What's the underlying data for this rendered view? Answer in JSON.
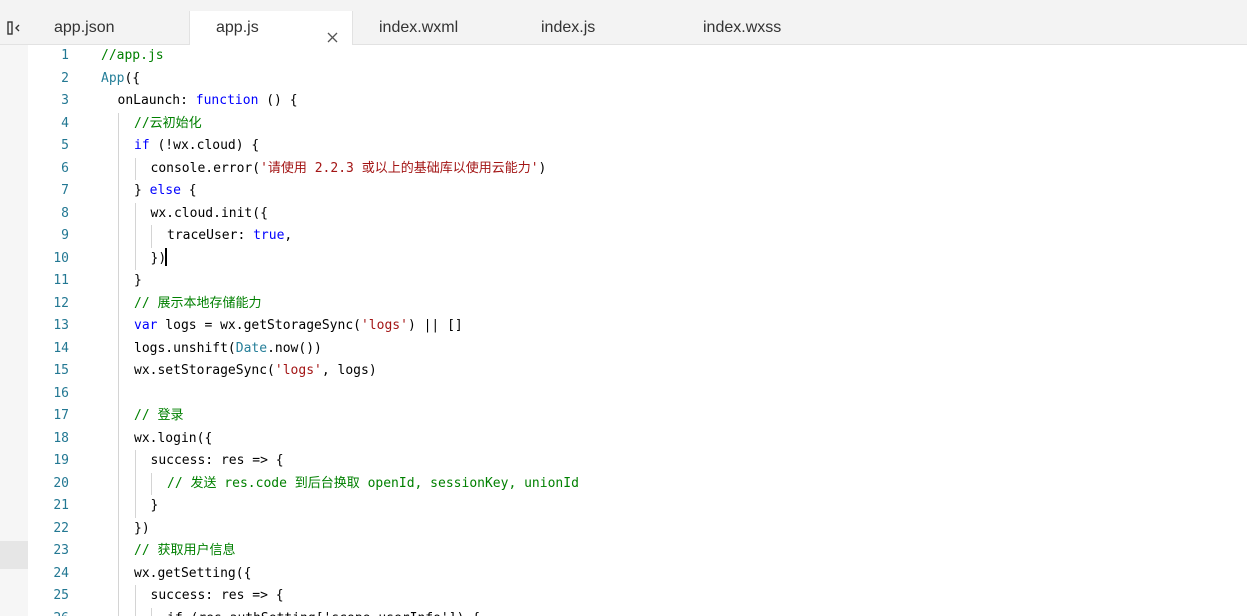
{
  "tabs": [
    {
      "label": "app.json",
      "active": false
    },
    {
      "label": "app.js",
      "active": true,
      "closable": true
    },
    {
      "label": "index.wxml",
      "active": false
    },
    {
      "label": "index.js",
      "active": false
    },
    {
      "label": "index.wxss",
      "active": false
    }
  ],
  "colors": {
    "comment": "#008000",
    "keyword": "#0000ff",
    "string": "#a31515",
    "type": "#267f99",
    "line_number": "#237893"
  },
  "editor": {
    "lines": [
      {
        "n": "1",
        "indent": 0,
        "tokens": [
          {
            "t": "//app.js",
            "c": "c"
          }
        ]
      },
      {
        "n": "2",
        "indent": 0,
        "tokens": [
          {
            "t": "App",
            "c": "y"
          },
          {
            "t": "({",
            "c": "p"
          }
        ]
      },
      {
        "n": "3",
        "indent": 1,
        "tokens": [
          {
            "t": "onLaunch: ",
            "c": "p"
          },
          {
            "t": "function",
            "c": "k"
          },
          {
            "t": " () {",
            "c": "p"
          }
        ]
      },
      {
        "n": "4",
        "indent": 2,
        "tokens": [
          {
            "t": "//云初始化",
            "c": "c"
          }
        ]
      },
      {
        "n": "5",
        "indent": 2,
        "tokens": [
          {
            "t": "if",
            "c": "k"
          },
          {
            "t": " (!wx.cloud) {",
            "c": "p"
          }
        ]
      },
      {
        "n": "6",
        "indent": 3,
        "tokens": [
          {
            "t": "console.error(",
            "c": "p"
          },
          {
            "t": "'请使用 2.2.3 或以上的基础库以使用云能力'",
            "c": "s"
          },
          {
            "t": ")",
            "c": "p"
          }
        ]
      },
      {
        "n": "7",
        "indent": 2,
        "tokens": [
          {
            "t": "} ",
            "c": "p"
          },
          {
            "t": "else",
            "c": "k"
          },
          {
            "t": " {",
            "c": "p"
          }
        ]
      },
      {
        "n": "8",
        "indent": 3,
        "tokens": [
          {
            "t": "wx.cloud.init({",
            "c": "p"
          }
        ]
      },
      {
        "n": "9",
        "indent": 4,
        "tokens": [
          {
            "t": "traceUser: ",
            "c": "p"
          },
          {
            "t": "true",
            "c": "k"
          },
          {
            "t": ",",
            "c": "p"
          }
        ]
      },
      {
        "n": "10",
        "indent": 3,
        "tokens": [
          {
            "t": "})",
            "c": "p"
          }
        ],
        "cursor": true
      },
      {
        "n": "11",
        "indent": 2,
        "tokens": [
          {
            "t": "}",
            "c": "p"
          }
        ]
      },
      {
        "n": "12",
        "indent": 2,
        "tokens": [
          {
            "t": "// 展示本地存储能力",
            "c": "c"
          }
        ]
      },
      {
        "n": "13",
        "indent": 2,
        "tokens": [
          {
            "t": "var",
            "c": "k"
          },
          {
            "t": " logs = wx.getStorageSync(",
            "c": "p"
          },
          {
            "t": "'logs'",
            "c": "s"
          },
          {
            "t": ") || []",
            "c": "p"
          }
        ]
      },
      {
        "n": "14",
        "indent": 2,
        "tokens": [
          {
            "t": "logs.unshift(",
            "c": "p"
          },
          {
            "t": "Date",
            "c": "y"
          },
          {
            "t": ".now())",
            "c": "p"
          }
        ]
      },
      {
        "n": "15",
        "indent": 2,
        "tokens": [
          {
            "t": "wx.setStorageSync(",
            "c": "p"
          },
          {
            "t": "'logs'",
            "c": "s"
          },
          {
            "t": ", logs)",
            "c": "p"
          }
        ]
      },
      {
        "n": "16",
        "indent": 2,
        "tokens": []
      },
      {
        "n": "17",
        "indent": 2,
        "tokens": [
          {
            "t": "// 登录",
            "c": "c"
          }
        ]
      },
      {
        "n": "18",
        "indent": 2,
        "tokens": [
          {
            "t": "wx.login({",
            "c": "p"
          }
        ]
      },
      {
        "n": "19",
        "indent": 3,
        "tokens": [
          {
            "t": "success: res => {",
            "c": "p"
          }
        ]
      },
      {
        "n": "20",
        "indent": 4,
        "tokens": [
          {
            "t": "// 发送 res.code 到后台换取 openId, sessionKey, unionId",
            "c": "c"
          }
        ]
      },
      {
        "n": "21",
        "indent": 3,
        "tokens": [
          {
            "t": "}",
            "c": "p"
          }
        ]
      },
      {
        "n": "22",
        "indent": 2,
        "tokens": [
          {
            "t": "})",
            "c": "p"
          }
        ]
      },
      {
        "n": "23",
        "indent": 2,
        "tokens": [
          {
            "t": "// 获取用户信息",
            "c": "c"
          }
        ]
      },
      {
        "n": "24",
        "indent": 2,
        "tokens": [
          {
            "t": "wx.getSetting({",
            "c": "p"
          }
        ]
      },
      {
        "n": "25",
        "indent": 3,
        "tokens": [
          {
            "t": "success: res => {",
            "c": "p"
          }
        ]
      },
      {
        "n": "26",
        "indent": 4,
        "tokens": [
          {
            "t": "if (res.authSetting['scope.userInfo']) {",
            "c": "p"
          }
        ]
      }
    ]
  }
}
